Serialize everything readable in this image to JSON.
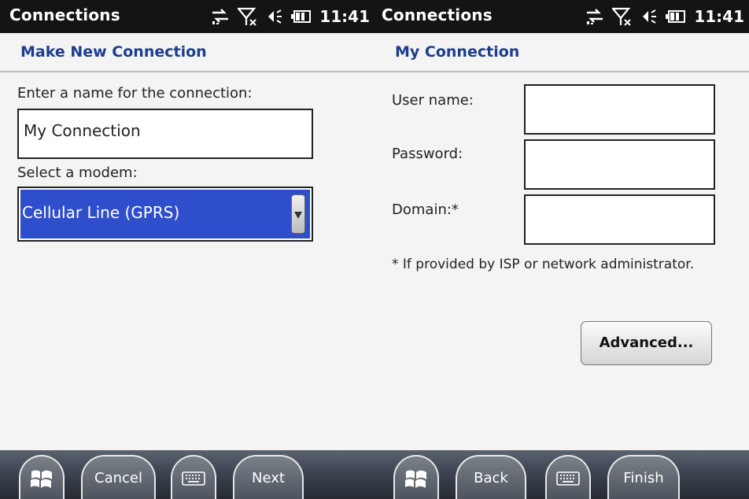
{
  "left": {
    "status_title": "Connections",
    "clock": "11:41",
    "header_title": "Make New Connection",
    "name_label": "Enter a name for the connection:",
    "name_value": "My Connection",
    "modem_label": "Select a modem:",
    "modem_selected": "Cellular Line (GPRS)",
    "softkeys": {
      "left": "Cancel",
      "right": "Next"
    }
  },
  "right": {
    "status_title": "Connections",
    "clock": "11:41",
    "header_title": "My Connection",
    "username_label": "User name:",
    "username_value": "",
    "password_label": "Password:",
    "password_value": "",
    "domain_label": "Domain:*",
    "domain_value": "",
    "footnote": "* If provided by ISP or network administrator.",
    "advanced_label": "Advanced...",
    "softkeys": {
      "left": "Back",
      "right": "Finish"
    }
  },
  "icons": {
    "status": [
      "data-sync-icon",
      "no-signal-icon",
      "volume-icon",
      "battery-icon"
    ],
    "softbar": [
      "windows-start-icon",
      "keyboard-icon"
    ]
  }
}
